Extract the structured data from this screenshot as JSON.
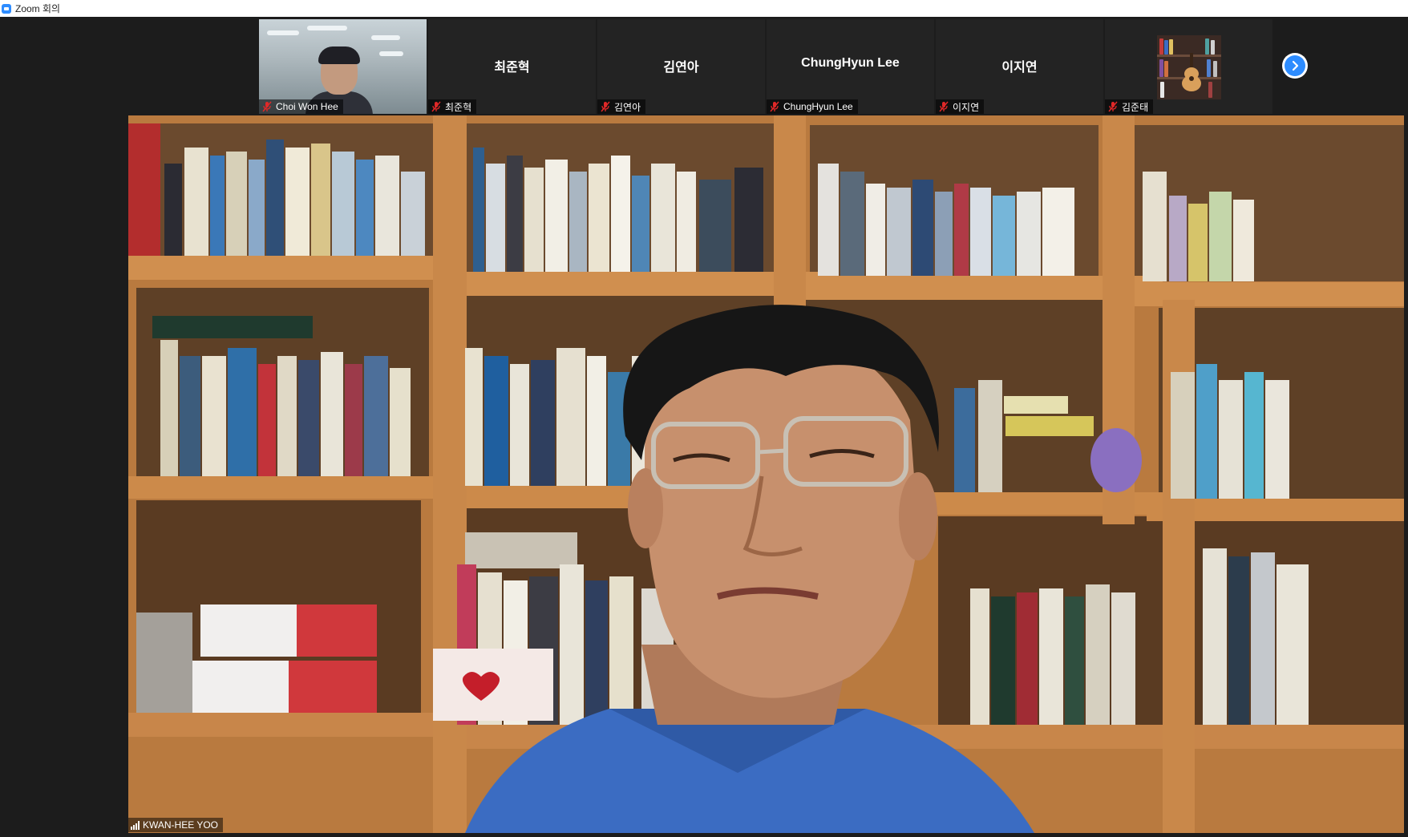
{
  "window": {
    "title": "Zoom 회의",
    "app_icon": "zoom-icon"
  },
  "thumbnails": [
    {
      "display": "video",
      "center_name": "",
      "label": "Choi Won Hee",
      "muted": true
    },
    {
      "display": "name",
      "center_name": "최준혁",
      "label": "최준혁",
      "muted": true
    },
    {
      "display": "name",
      "center_name": "김연아",
      "label": "김연아",
      "muted": true
    },
    {
      "display": "name",
      "center_name": "ChungHyun Lee",
      "label": "ChungHyun Lee",
      "muted": true
    },
    {
      "display": "name",
      "center_name": "이지연",
      "label": "이지연",
      "muted": true
    },
    {
      "display": "avatar",
      "center_name": "",
      "label": "김준태",
      "muted": true
    }
  ],
  "next_page_icon": "chevron-right-icon",
  "active_speaker": {
    "name": "KWAN-HEE YOO",
    "signal_icon": "connection-signal-icon"
  },
  "colors": {
    "accent": "#2d8cff",
    "muted_icon": "#e02828",
    "meeting_bg": "#1c1c1c"
  }
}
